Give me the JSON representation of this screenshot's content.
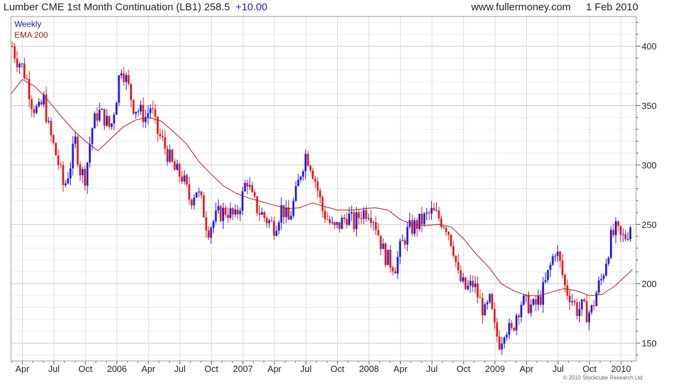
{
  "header": {
    "title": "Lumber CME 1st Month Continuation (LB1)",
    "price": "258.5",
    "change": "+10.00",
    "website": "www.fullermoney.com",
    "date": "1 Feb 2010"
  },
  "legend": {
    "series1": "Weekly",
    "series2": "EMA 200"
  },
  "footer": "© 2010 Stockcube Research Ltd",
  "colors": {
    "up": "#1a1ae6",
    "down": "#e61a1a",
    "ema": "#a02020",
    "grid": "#dcdcdc",
    "legend_weekly": "#1a1acc",
    "legend_ema": "#a02020"
  },
  "chart_data": {
    "type": "candlestick",
    "frequency": "weekly",
    "ylim": [
      135,
      425
    ],
    "yticks": [
      150,
      200,
      250,
      300,
      350,
      400
    ],
    "x_range": [
      2005.16,
      2010.12
    ],
    "xticks": [
      {
        "label": "Apr",
        "x": 2005.25
      },
      {
        "label": "Jul",
        "x": 2005.5
      },
      {
        "label": "Oct",
        "x": 2005.75
      },
      {
        "label": "2006",
        "x": 2006.0
      },
      {
        "label": "Apr",
        "x": 2006.25
      },
      {
        "label": "Jul",
        "x": 2006.5
      },
      {
        "label": "Oct",
        "x": 2006.75
      },
      {
        "label": "2007",
        "x": 2007.0
      },
      {
        "label": "Apr",
        "x": 2007.25
      },
      {
        "label": "Jul",
        "x": 2007.5
      },
      {
        "label": "Oct",
        "x": 2007.75
      },
      {
        "label": "2008",
        "x": 2008.0
      },
      {
        "label": "Apr",
        "x": 2008.25
      },
      {
        "label": "Jul",
        "x": 2008.5
      },
      {
        "label": "Oct",
        "x": 2008.75
      },
      {
        "label": "2009",
        "x": 2009.0
      },
      {
        "label": "Apr",
        "x": 2009.25
      },
      {
        "label": "Jul",
        "x": 2009.5
      },
      {
        "label": "Oct",
        "x": 2009.75
      },
      {
        "label": "2010",
        "x": 2010.0
      }
    ],
    "close_path": [
      [
        2005.17,
        400
      ],
      [
        2005.2,
        390
      ],
      [
        2005.24,
        385
      ],
      [
        2005.29,
        370
      ],
      [
        2005.33,
        350
      ],
      [
        2005.38,
        345
      ],
      [
        2005.42,
        355
      ],
      [
        2005.46,
        330
      ],
      [
        2005.5,
        315
      ],
      [
        2005.54,
        300
      ],
      [
        2005.58,
        280
      ],
      [
        2005.63,
        300
      ],
      [
        2005.67,
        320
      ],
      [
        2005.71,
        295
      ],
      [
        2005.75,
        290
      ],
      [
        2005.8,
        330
      ],
      [
        2005.85,
        345
      ],
      [
        2005.9,
        340
      ],
      [
        2005.95,
        330
      ],
      [
        2006.0,
        360
      ],
      [
        2006.03,
        385
      ],
      [
        2006.08,
        370
      ],
      [
        2006.13,
        350
      ],
      [
        2006.18,
        345
      ],
      [
        2006.23,
        340
      ],
      [
        2006.27,
        350
      ],
      [
        2006.31,
        330
      ],
      [
        2006.36,
        320
      ],
      [
        2006.42,
        305
      ],
      [
        2006.46,
        295
      ],
      [
        2006.52,
        290
      ],
      [
        2006.58,
        270
      ],
      [
        2006.63,
        280
      ],
      [
        2006.68,
        265
      ],
      [
        2006.72,
        245
      ],
      [
        2006.75,
        250
      ],
      [
        2006.8,
        258
      ],
      [
        2006.87,
        262
      ],
      [
        2006.94,
        255
      ],
      [
        2007.0,
        275
      ],
      [
        2007.03,
        290
      ],
      [
        2007.07,
        272
      ],
      [
        2007.12,
        262
      ],
      [
        2007.18,
        255
      ],
      [
        2007.25,
        248
      ],
      [
        2007.31,
        265
      ],
      [
        2007.36,
        252
      ],
      [
        2007.42,
        275
      ],
      [
        2007.46,
        295
      ],
      [
        2007.5,
        310
      ],
      [
        2007.54,
        300
      ],
      [
        2007.58,
        285
      ],
      [
        2007.63,
        262
      ],
      [
        2007.67,
        255
      ],
      [
        2007.72,
        245
      ],
      [
        2007.77,
        250
      ],
      [
        2007.83,
        258
      ],
      [
        2007.88,
        250
      ],
      [
        2007.94,
        260
      ],
      [
        2008.0,
        262
      ],
      [
        2008.04,
        255
      ],
      [
        2008.08,
        240
      ],
      [
        2008.12,
        225
      ],
      [
        2008.17,
        218
      ],
      [
        2008.21,
        215
      ],
      [
        2008.25,
        230
      ],
      [
        2008.31,
        245
      ],
      [
        2008.38,
        250
      ],
      [
        2008.44,
        255
      ],
      [
        2008.5,
        260
      ],
      [
        2008.56,
        255
      ],
      [
        2008.62,
        248
      ],
      [
        2008.67,
        230
      ],
      [
        2008.71,
        205
      ],
      [
        2008.77,
        195
      ],
      [
        2008.83,
        200
      ],
      [
        2008.88,
        185
      ],
      [
        2008.92,
        175
      ],
      [
        2008.96,
        185
      ],
      [
        2009.0,
        160
      ],
      [
        2009.04,
        150
      ],
      [
        2009.08,
        165
      ],
      [
        2009.13,
        158
      ],
      [
        2009.17,
        175
      ],
      [
        2009.21,
        185
      ],
      [
        2009.27,
        182
      ],
      [
        2009.31,
        180
      ],
      [
        2009.36,
        188
      ],
      [
        2009.4,
        200
      ],
      [
        2009.44,
        215
      ],
      [
        2009.48,
        230
      ],
      [
        2009.52,
        215
      ],
      [
        2009.56,
        195
      ],
      [
        2009.6,
        190
      ],
      [
        2009.65,
        178
      ],
      [
        2009.69,
        180
      ],
      [
        2009.73,
        175
      ],
      [
        2009.77,
        178
      ],
      [
        2009.81,
        195
      ],
      [
        2009.85,
        205
      ],
      [
        2009.88,
        220
      ],
      [
        2009.92,
        238
      ],
      [
        2009.96,
        245
      ],
      [
        2010.0,
        238
      ],
      [
        2010.04,
        240
      ],
      [
        2010.07,
        248
      ],
      [
        2010.09,
        258
      ]
    ],
    "ema_path": [
      [
        2005.16,
        360
      ],
      [
        2005.25,
        372
      ],
      [
        2005.35,
        366
      ],
      [
        2005.45,
        355
      ],
      [
        2005.55,
        342
      ],
      [
        2005.65,
        330
      ],
      [
        2005.75,
        320
      ],
      [
        2005.85,
        312
      ],
      [
        2005.95,
        322
      ],
      [
        2006.05,
        332
      ],
      [
        2006.15,
        338
      ],
      [
        2006.25,
        340
      ],
      [
        2006.35,
        337
      ],
      [
        2006.45,
        328
      ],
      [
        2006.55,
        318
      ],
      [
        2006.65,
        303
      ],
      [
        2006.75,
        292
      ],
      [
        2006.85,
        282
      ],
      [
        2006.95,
        276
      ],
      [
        2007.05,
        272
      ],
      [
        2007.15,
        269
      ],
      [
        2007.25,
        266
      ],
      [
        2007.35,
        263
      ],
      [
        2007.45,
        264
      ],
      [
        2007.55,
        268
      ],
      [
        2007.65,
        265
      ],
      [
        2007.75,
        262
      ],
      [
        2007.85,
        262
      ],
      [
        2007.95,
        263
      ],
      [
        2008.05,
        264
      ],
      [
        2008.15,
        262
      ],
      [
        2008.25,
        254
      ],
      [
        2008.35,
        250
      ],
      [
        2008.45,
        249
      ],
      [
        2008.55,
        250
      ],
      [
        2008.65,
        248
      ],
      [
        2008.75,
        238
      ],
      [
        2008.85,
        225
      ],
      [
        2008.95,
        214
      ],
      [
        2009.05,
        200
      ],
      [
        2009.15,
        194
      ],
      [
        2009.25,
        190
      ],
      [
        2009.35,
        190
      ],
      [
        2009.45,
        193
      ],
      [
        2009.55,
        196
      ],
      [
        2009.65,
        194
      ],
      [
        2009.75,
        190
      ],
      [
        2009.85,
        191
      ],
      [
        2009.95,
        198
      ],
      [
        2010.05,
        208
      ],
      [
        2010.09,
        212
      ]
    ]
  }
}
